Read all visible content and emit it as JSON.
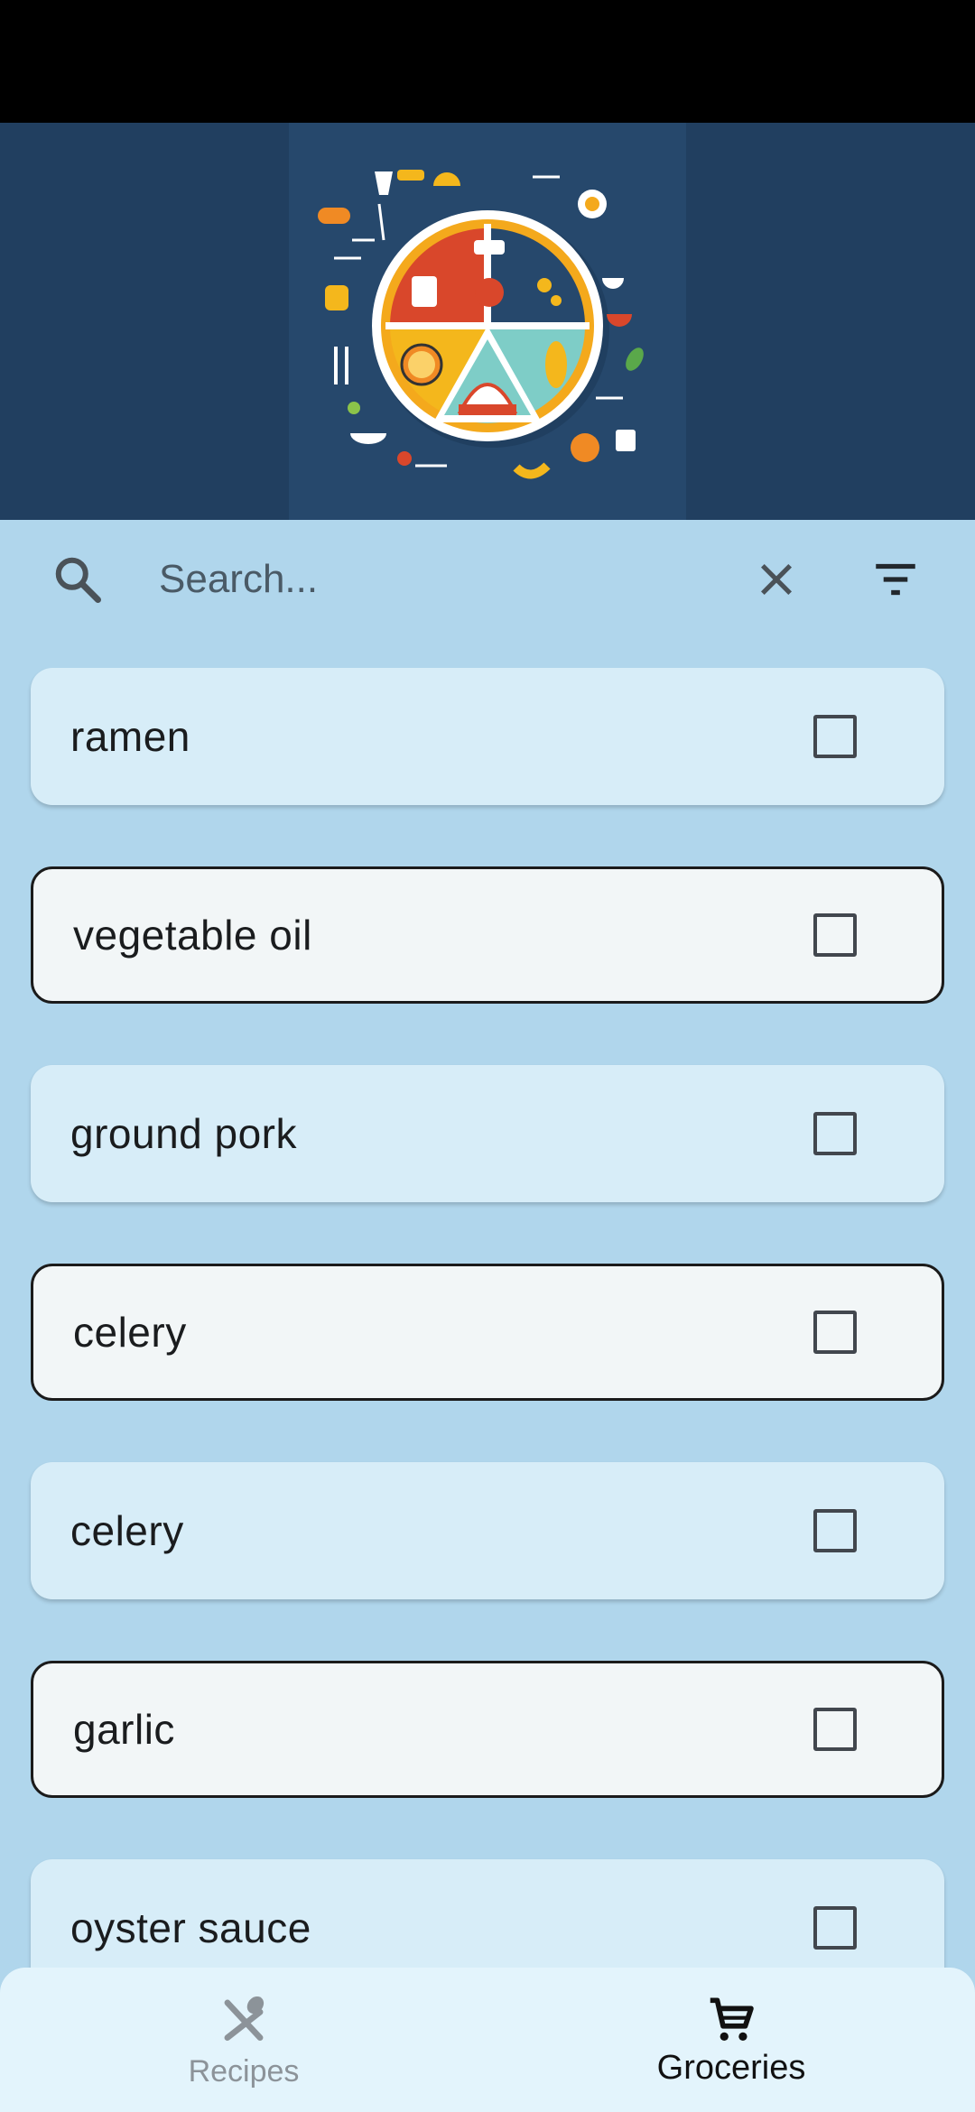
{
  "search": {
    "placeholder": "Search..."
  },
  "groceries": [
    {
      "name": "ramen",
      "checked": false,
      "style": "filled"
    },
    {
      "name": "vegetable oil",
      "checked": false,
      "style": "outlined"
    },
    {
      "name": "ground pork",
      "checked": false,
      "style": "filled"
    },
    {
      "name": "celery",
      "checked": false,
      "style": "outlined"
    },
    {
      "name": "celery",
      "checked": false,
      "style": "filled"
    },
    {
      "name": "garlic",
      "checked": false,
      "style": "outlined"
    },
    {
      "name": "oyster sauce",
      "checked": false,
      "style": "filled"
    }
  ],
  "nav": {
    "recipes_label": "Recipes",
    "groceries_label": "Groceries",
    "active": "groceries"
  },
  "colors": {
    "header_bg": "#213f60",
    "page_bg": "#b0d6ec",
    "card_filled": "#d7edf8",
    "card_outlined": "#f2f6f7",
    "nav_bg": "#e3f4fc"
  }
}
